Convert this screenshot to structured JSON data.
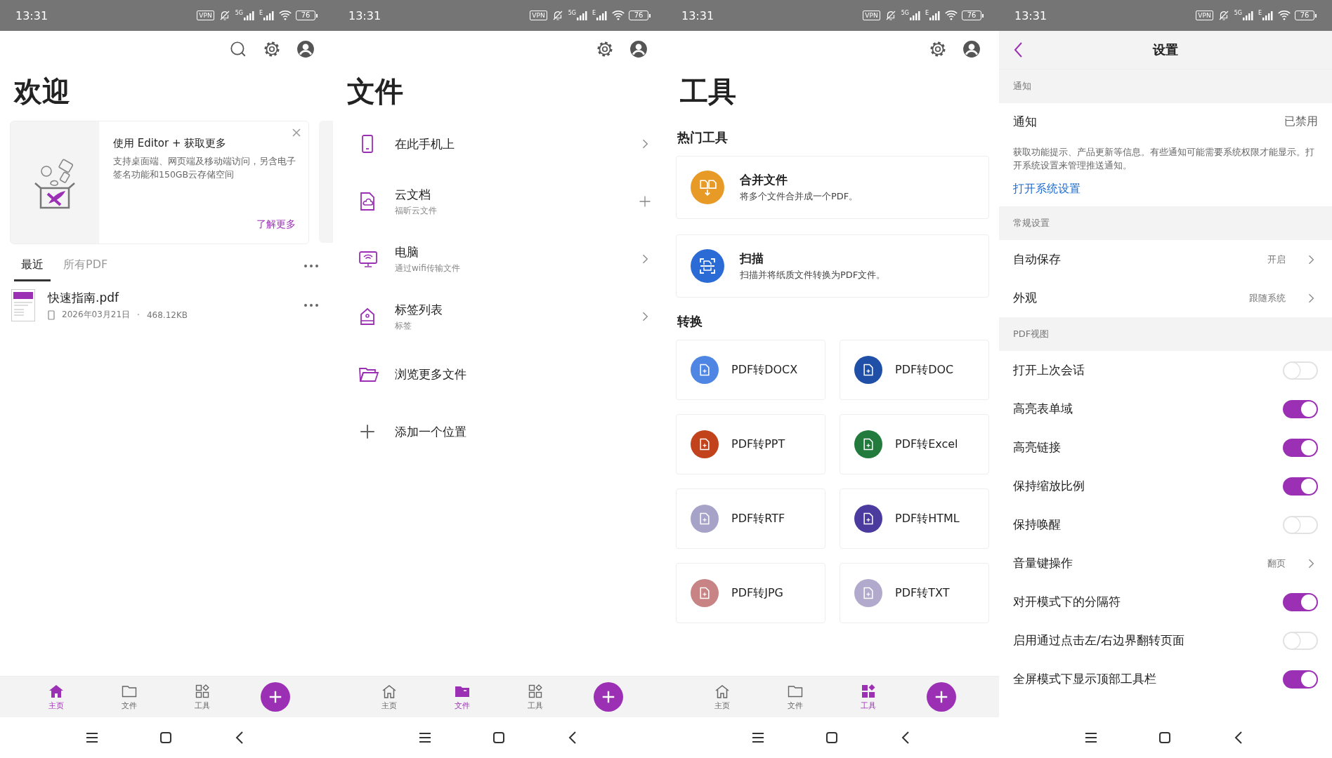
{
  "screens": [
    {
      "kind": "home",
      "status_bar": {
        "time": "13:31",
        "vpn": "VPN",
        "networks": [
          "5G",
          "E"
        ],
        "battery": "76"
      },
      "toolbar": [
        {
          "kind": "search"
        },
        {
          "kind": "settings"
        },
        {
          "kind": "account"
        }
      ],
      "title": "欢迎",
      "promo": {
        "title": "使用 Editor + 获取更多",
        "text": "支持桌面端、网页端及移动端访问，另含电子签名功能和150GB云存储空间",
        "link": "了解更多"
      },
      "tabs": [
        {
          "label": "最近",
          "selected": true
        },
        {
          "label": "所有PDF",
          "selected": false
        }
      ],
      "files": [
        {
          "name": "快速指南.pdf",
          "date": "2026年03月21日",
          "separator": "·",
          "size": "468.12KB"
        }
      ],
      "nav": [
        {
          "kind": "home",
          "label": "主页",
          "selected": true
        },
        {
          "kind": "files",
          "label": "文件",
          "selected": false
        },
        {
          "kind": "tools",
          "label": "工具",
          "selected": false
        }
      ]
    },
    {
      "kind": "files",
      "status_bar": {
        "time": "13:31",
        "vpn": "VPN",
        "networks": [
          "5G",
          "E"
        ],
        "battery": "76"
      },
      "toolbar": [
        {
          "kind": "settings"
        },
        {
          "kind": "account"
        }
      ],
      "title": "文件",
      "items": [
        {
          "kind": "phone",
          "label": "在此手机上",
          "trailing": {
            "kind": "chevron"
          }
        },
        {
          "kind": "cloud",
          "label": "云文档",
          "sublabel": "福昕云文件",
          "trailing": {
            "kind": "plus"
          }
        },
        {
          "kind": "computer",
          "label": "电脑",
          "sublabel": "通过wifi传输文件",
          "trailing": {
            "kind": "chevron"
          }
        },
        {
          "kind": "tag",
          "label": "标签列表",
          "sublabel": "标签",
          "trailing": {
            "kind": "chevron"
          }
        },
        {
          "kind": "folder",
          "label": "浏览更多文件"
        },
        {
          "kind": "add",
          "label": "添加一个位置"
        }
      ],
      "nav": [
        {
          "kind": "home",
          "label": "主页",
          "selected": false
        },
        {
          "kind": "files",
          "label": "文件",
          "selected": true
        },
        {
          "kind": "tools",
          "label": "工具",
          "selected": false
        }
      ]
    },
    {
      "kind": "tools",
      "status_bar": {
        "time": "13:31",
        "vpn": "VPN",
        "networks": [
          "5G",
          "E"
        ],
        "battery": "76"
      },
      "toolbar": [
        {
          "kind": "settings"
        },
        {
          "kind": "account"
        }
      ],
      "title": "工具",
      "hot_heading": "热门工具",
      "hot_tools": [
        {
          "kind": "merge",
          "name": "合并文件",
          "description": "将多个文件合并成一个PDF。",
          "color": "#e89a26"
        },
        {
          "kind": "scan",
          "name": "扫描",
          "description": "扫描并将纸质文件转换为PDF文件。",
          "color": "#2a6bd6"
        }
      ],
      "convert_heading": "转换",
      "conversions": [
        {
          "label": "PDF转DOCX",
          "color": "#4f86e3"
        },
        {
          "label": "PDF转DOC",
          "color": "#1f4fa6"
        },
        {
          "label": "PDF转PPT",
          "color": "#c2421c"
        },
        {
          "label": "PDF转Excel",
          "color": "#227a3c"
        },
        {
          "label": "PDF转RTF",
          "color": "#a7a2c8"
        },
        {
          "label": "PDF转HTML",
          "color": "#4b3b9e"
        },
        {
          "label": "PDF转JPG",
          "color": "#c88484"
        },
        {
          "label": "PDF转TXT",
          "color": "#b2aacd"
        }
      ],
      "nav": [
        {
          "kind": "home",
          "label": "主页",
          "selected": false
        },
        {
          "kind": "files",
          "label": "文件",
          "selected": false
        },
        {
          "kind": "tools",
          "label": "工具",
          "selected": true
        }
      ]
    },
    {
      "kind": "settings",
      "status_bar": {
        "time": "13:31",
        "vpn": "VPN",
        "networks": [
          "5G",
          "E"
        ],
        "battery": "76"
      },
      "title": "设置",
      "sections": [
        {
          "header": "通知",
          "rows": [
            {
              "kind": "value",
              "label": "通知",
              "value": "已禁用"
            },
            {
              "kind": "note",
              "text": "获取功能提示、产品更新等信息。有些通知可能需要系统权限才能显示。打开系统设置来管理推送通知。"
            },
            {
              "kind": "link",
              "text": "打开系统设置"
            }
          ]
        },
        {
          "header": "常规设置",
          "rows": [
            {
              "kind": "nav",
              "label": "自动保存",
              "value": "开启"
            },
            {
              "kind": "nav",
              "label": "外观",
              "value": "跟随系统"
            }
          ]
        },
        {
          "header": "PDF视图",
          "rows": [
            {
              "kind": "toggle",
              "label": "打开上次会话",
              "on": false
            },
            {
              "kind": "toggle",
              "label": "高亮表单域",
              "on": true
            },
            {
              "kind": "toggle",
              "label": "高亮链接",
              "on": true
            },
            {
              "kind": "toggle",
              "label": "保持缩放比例",
              "on": true
            },
            {
              "kind": "toggle",
              "label": "保持唤醒",
              "on": false
            },
            {
              "kind": "nav",
              "label": "音量键操作",
              "value": "翻页"
            },
            {
              "kind": "toggle",
              "label": "对开模式下的分隔符",
              "on": true
            },
            {
              "kind": "toggle",
              "label": "启用通过点击左/右边界翻转页面",
              "on": false
            },
            {
              "kind": "toggle",
              "label": "全屏模式下显示顶部工具栏",
              "on": true
            }
          ]
        }
      ]
    }
  ]
}
